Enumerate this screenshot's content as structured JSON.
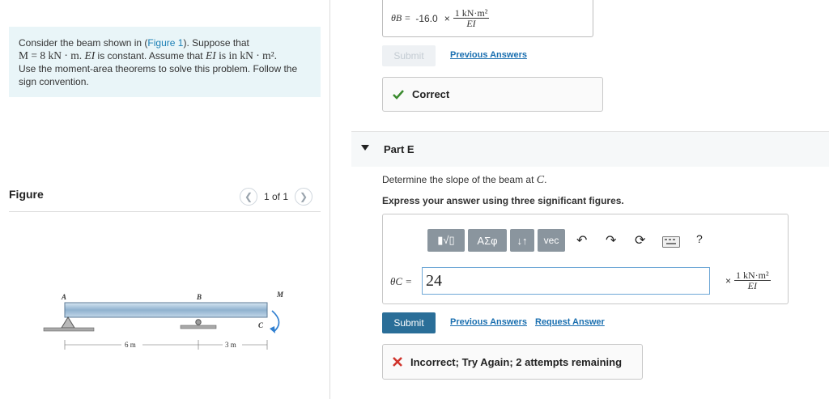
{
  "problem": {
    "intro": "Consider the beam shown in (",
    "figure_link": "Figure 1",
    "intro_end": "). Suppose that",
    "m_line": "M = 8 kN · m.",
    "ei_line_a": "EI",
    "ei_line_b": " is constant. Assume that ",
    "ei_line_c": "EI",
    "ei_line_d": " is in kN · m².",
    "rest": "Use the moment-area theorems to solve this problem. Follow the sign convention."
  },
  "figure": {
    "title": "Figure",
    "pager_text": "1 of 1",
    "labels": {
      "A": "A",
      "B": "B",
      "C": "C",
      "M": "M",
      "d1": "6 m",
      "d2": "3 m"
    }
  },
  "previous_part": {
    "variable": "θB =",
    "value": "-16.0",
    "times": "×",
    "unit_num": "1 kN·m²",
    "unit_den": "EI",
    "submit_label": "Submit",
    "prev_answers_label": "Previous Answers",
    "feedback": "Correct"
  },
  "partE": {
    "title": "Part E",
    "question_prefix": "Determine the slope of the beam at ",
    "question_var": "C",
    "question_suffix": ".",
    "instruction": "Express your answer using three significant figures.",
    "toolbar": {
      "templates": "▮√▯",
      "greek": "ΑΣφ",
      "arrows": "↓↑",
      "vec": "vec",
      "help": "?"
    },
    "variable": "θC =",
    "input_value": "24",
    "times": "×",
    "unit_num": "1 kN·m²",
    "unit_den": "EI",
    "submit_label": "Submit",
    "prev_answers_label": "Previous Answers",
    "request_answer_label": "Request Answer",
    "feedback": "Incorrect; Try Again; 2 attempts remaining"
  },
  "colors": {
    "correct": "#3a8a2e",
    "incorrect": "#d0342c",
    "link": "#1a6fb0",
    "submit": "#2a6e98"
  }
}
